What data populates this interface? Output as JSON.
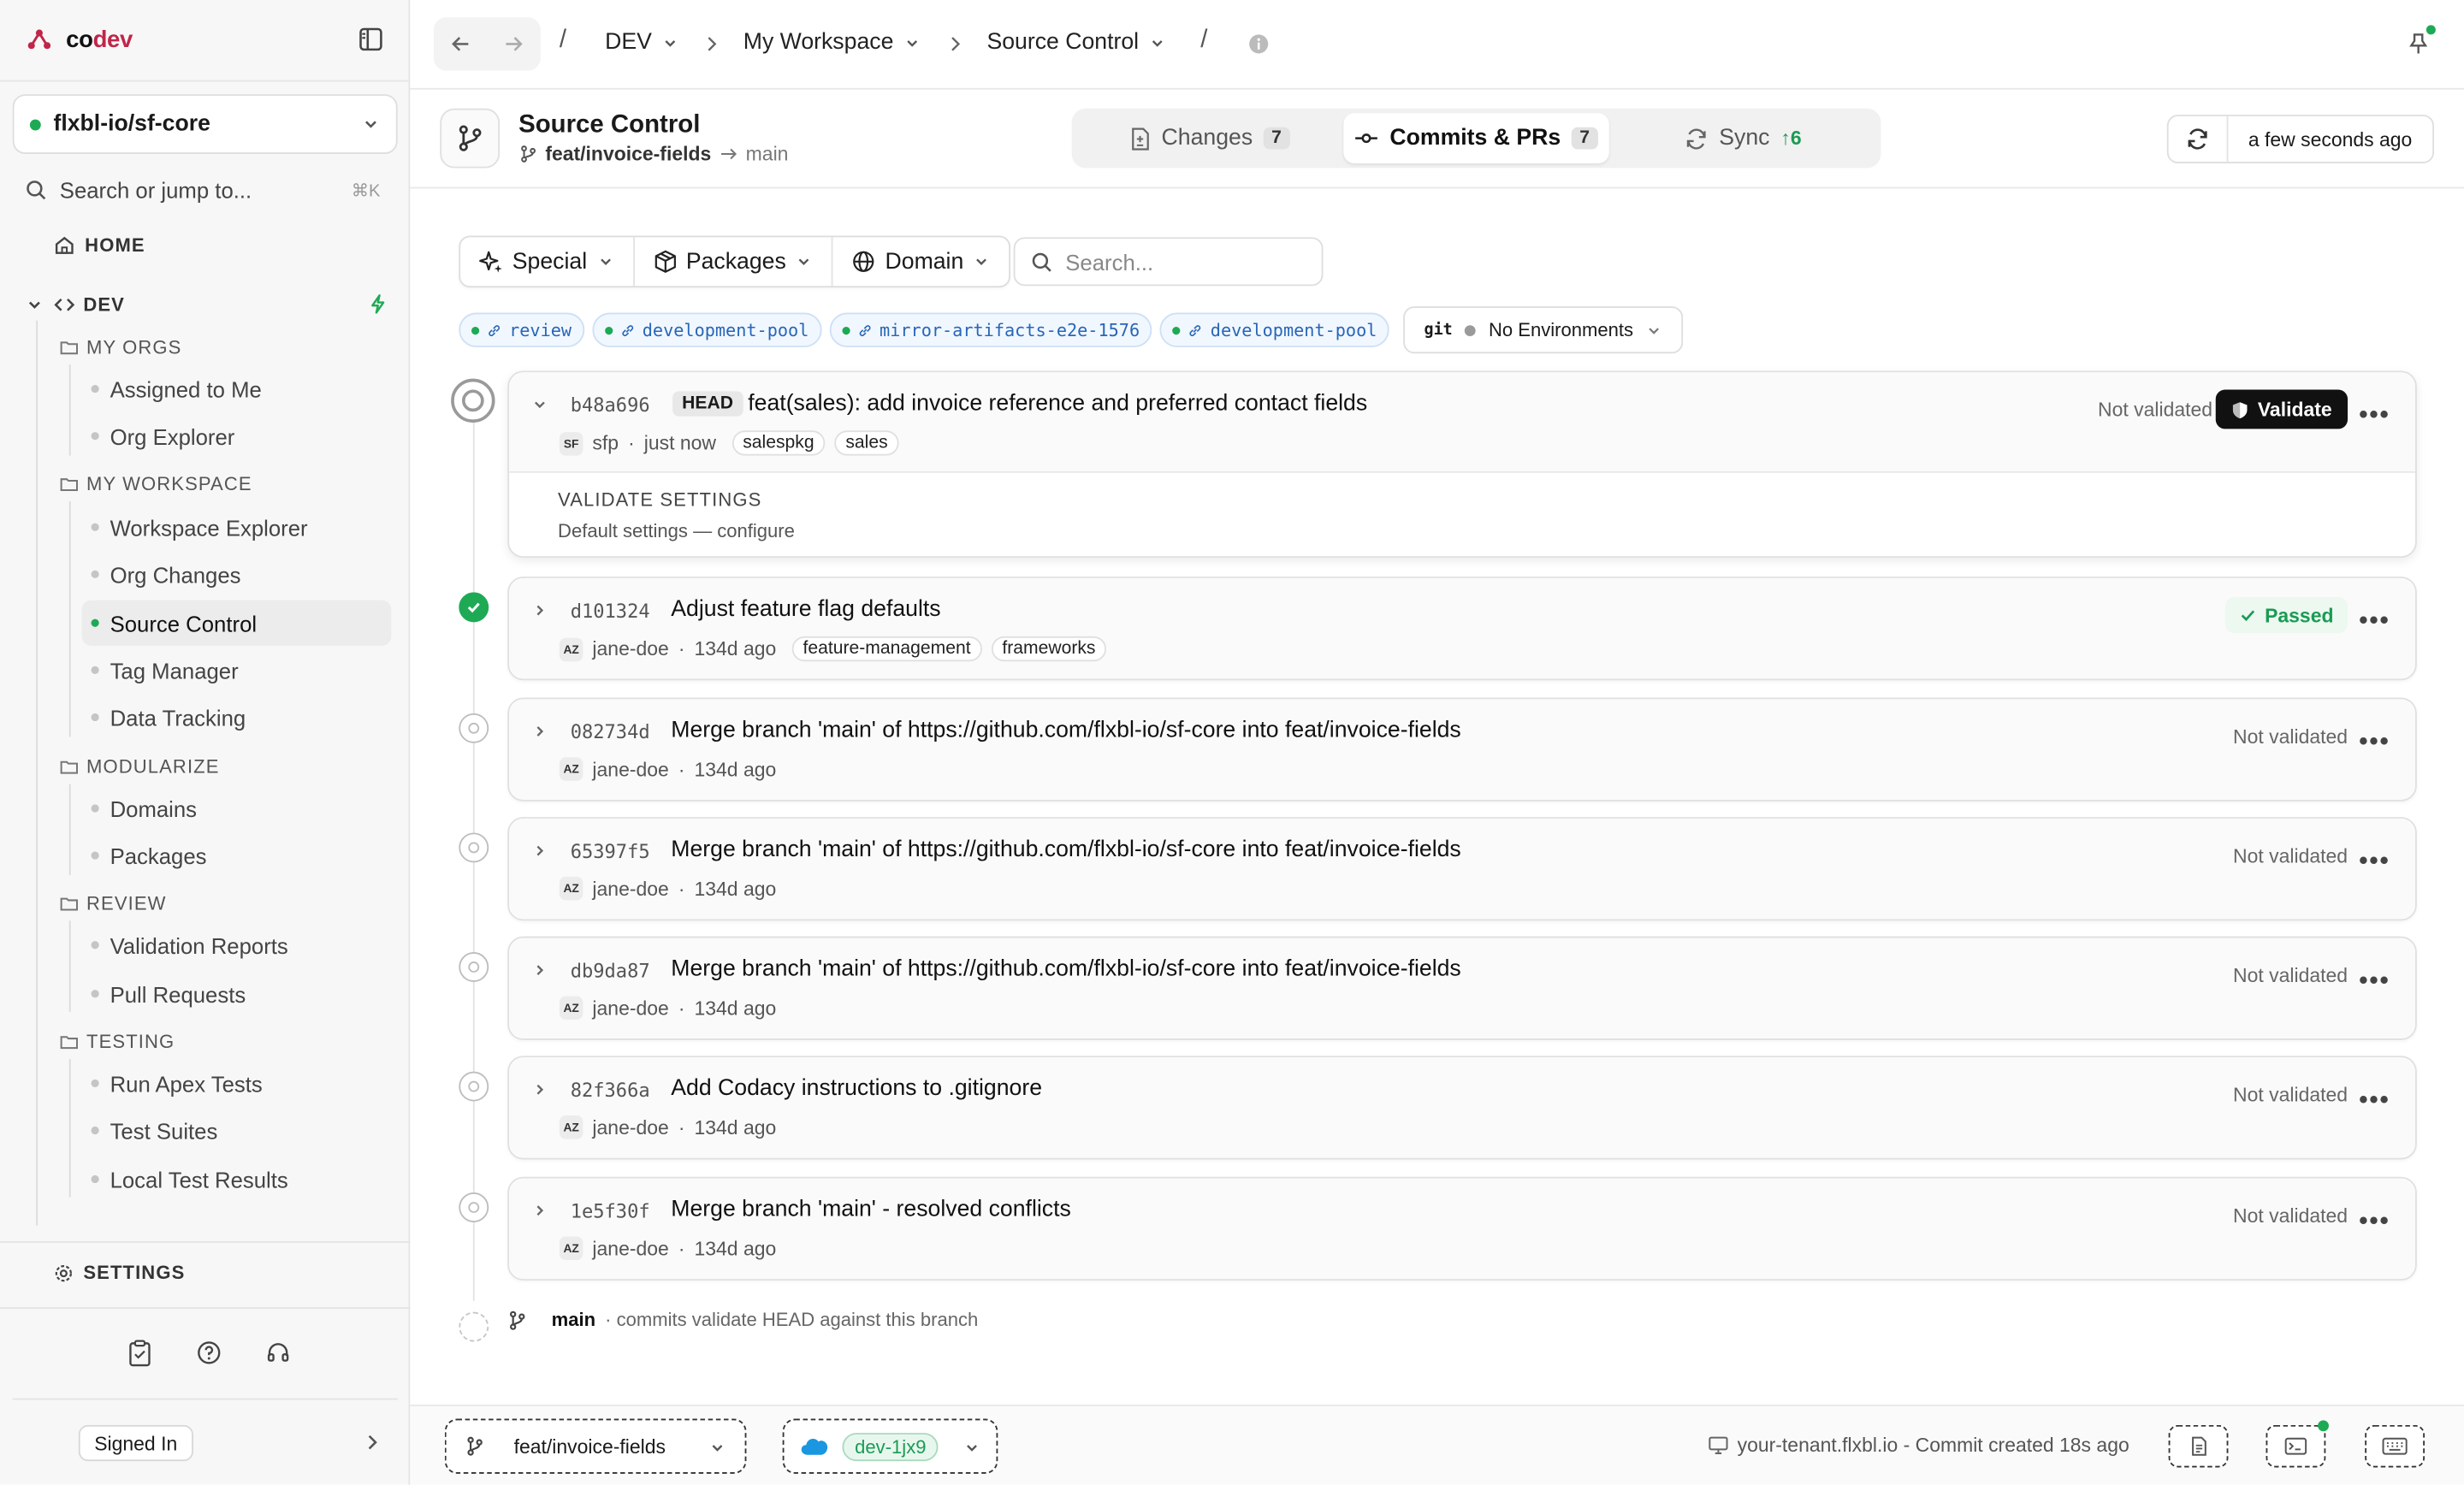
{
  "brand": {
    "name_part1": "co",
    "name_part2": "dev"
  },
  "org": {
    "name": "flxbl-io/sf-core"
  },
  "search_jump": {
    "label": "Search or jump to...",
    "shortcut": "⌘K"
  },
  "sidebar": {
    "home": "HOME",
    "dev": "DEV",
    "sections": [
      {
        "label": "MY ORGS",
        "items": [
          "Assigned to Me",
          "Org Explorer"
        ]
      },
      {
        "label": "MY WORKSPACE",
        "items": [
          "Workspace Explorer",
          "Org Changes",
          "Source Control",
          "Tag Manager",
          "Data Tracking"
        ]
      },
      {
        "label": "MODULARIZE",
        "items": [
          "Domains",
          "Packages"
        ]
      },
      {
        "label": "REVIEW",
        "items": [
          "Validation Reports",
          "Pull Requests"
        ]
      },
      {
        "label": "TESTING",
        "items": [
          "Run Apex Tests",
          "Test Suites",
          "Local Test Results"
        ]
      }
    ],
    "active_item": "Source Control",
    "settings": "SETTINGS",
    "signed_in": "Signed In"
  },
  "breadcrumb": {
    "sep": "/",
    "items": [
      "DEV",
      "My Workspace",
      "Source Control"
    ]
  },
  "header": {
    "title": "Source Control",
    "branch": "feat/invoice-fields",
    "target": "main",
    "tabs": [
      {
        "label": "Changes",
        "count": "7"
      },
      {
        "label": "Commits & PRs",
        "count": "7"
      },
      {
        "label": "Sync",
        "count": "↑6"
      }
    ],
    "refresh_label": "a few seconds ago"
  },
  "filters": {
    "buttons": [
      "Special",
      "Packages",
      "Domain"
    ],
    "search_placeholder": "Search...",
    "env_chips": [
      "review",
      "development-pool",
      "mirror-artifacts-e2e-1576",
      "development-pool"
    ],
    "git_label": "git",
    "no_env": "No Environments"
  },
  "commits": [
    {
      "sha": "b48a696",
      "head": "HEAD",
      "message": "feat(sales): add invoice reference and preferred contact fields",
      "avatar": "SF",
      "author": "sfp",
      "time": "just now",
      "tags": [
        "salespkg",
        "sales"
      ],
      "status": "Not validated",
      "action": "Validate",
      "expanded_title": "VALIDATE SETTINGS",
      "expanded_sub": "Default settings — configure"
    },
    {
      "sha": "d101324",
      "message": "Adjust feature flag defaults",
      "avatar": "AZ",
      "author": "jane-doe",
      "time": "134d ago",
      "tags": [
        "feature-management",
        "frameworks"
      ],
      "status": "Passed"
    },
    {
      "sha": "082734d",
      "message": "Merge branch 'main' of https://github.com/flxbl-io/sf-core into feat/invoice-fields",
      "avatar": "AZ",
      "author": "jane-doe",
      "time": "134d ago",
      "status": "Not validated"
    },
    {
      "sha": "65397f5",
      "message": "Merge branch 'main' of https://github.com/flxbl-io/sf-core into feat/invoice-fields",
      "avatar": "AZ",
      "author": "jane-doe",
      "time": "134d ago",
      "status": "Not validated"
    },
    {
      "sha": "db9da87",
      "message": "Merge branch 'main' of https://github.com/flxbl-io/sf-core into feat/invoice-fields",
      "avatar": "AZ",
      "author": "jane-doe",
      "time": "134d ago",
      "status": "Not validated"
    },
    {
      "sha": "82f366a",
      "message": "Add Codacy instructions to .gitignore",
      "avatar": "AZ",
      "author": "jane-doe",
      "time": "134d ago",
      "status": "Not validated"
    },
    {
      "sha": "1e5f30f",
      "message": "Merge branch 'main' - resolved conflicts",
      "avatar": "AZ",
      "author": "jane-doe",
      "time": "134d ago",
      "status": "Not validated"
    }
  ],
  "base": {
    "branch": "main",
    "note": "· commits validate HEAD against this branch"
  },
  "meta_sep": "·",
  "footer": {
    "branch": "feat/invoice-fields",
    "org": "dev-1jx9",
    "info": "your-tenant.flxbl.io - Commit created 18s ago"
  },
  "colors": {
    "accent_green": "#1eaa55",
    "brand_red": "#c0264a",
    "chip_blue": "#2866b8"
  }
}
